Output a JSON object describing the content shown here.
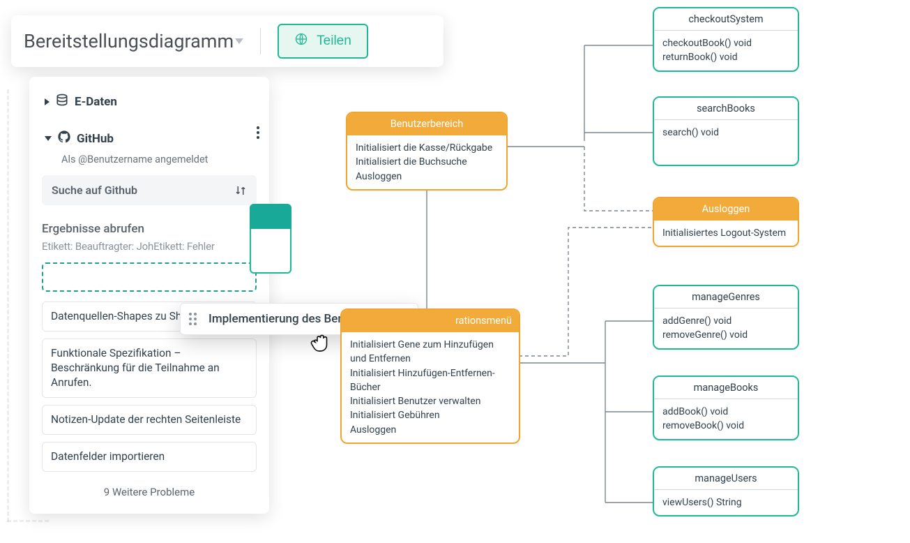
{
  "header": {
    "title": "Bereitstellungsdiagramm",
    "share_label": "Teilen"
  },
  "sidebar": {
    "e_daten_label": "E-Daten",
    "github": {
      "label": "GitHub",
      "subtext": "Als @Benutzername angemeldet"
    },
    "search_placeholder": "Suche auf Github",
    "results_label": "Ergebnisse abrufen",
    "chips": {
      "line": "Etikett: Beauftragter: JohEtikett: Fehler"
    },
    "issues": [
      "Datenquellen-Shapes zu Sha...",
      "Funktionale Spezifikation – Beschränkung für die Teilnahme an Anrufen.",
      "Notizen-Update der rechten Seitenleiste",
      "Datenfelder importieren"
    ],
    "more_label": "9 Weitere Probleme"
  },
  "drag_ghost_label": "Implementierung des Benutzerpanels",
  "nodes": {
    "user_area": {
      "title": "Benutzerbereich",
      "lines": [
        "Initialisiert die Kasse/Rückgabe",
        "Initialisiert die Buchsuche",
        "Ausloggen"
      ]
    },
    "admin_menu": {
      "title_suffix": "rationsmenü",
      "lines": [
        "Initialisiert Gene zum Hinzufügen und Entfernen",
        "Initialisiert Hinzufügen-Entfernen-Bücher",
        "Initialisiert Benutzer verwalten",
        "Initialisiert Gebühren",
        "Ausloggen"
      ]
    },
    "checkout": {
      "title": "checkoutSystem",
      "lines": [
        "checkoutBook() void",
        "returnBook() void"
      ]
    },
    "search": {
      "title": "searchBooks",
      "lines": [
        "search() void"
      ]
    },
    "logout": {
      "title": "Ausloggen",
      "lines": [
        "Initialisiertes Logout-System"
      ]
    },
    "genres": {
      "title": "manageGenres",
      "lines": [
        "addGenre() void",
        "removeGenre() void"
      ]
    },
    "books": {
      "title": "manageBooks",
      "lines": [
        "addBook() void",
        "removeBook() void"
      ]
    },
    "users": {
      "title": "manageUsers",
      "lines": [
        "viewUsers() String"
      ]
    }
  }
}
